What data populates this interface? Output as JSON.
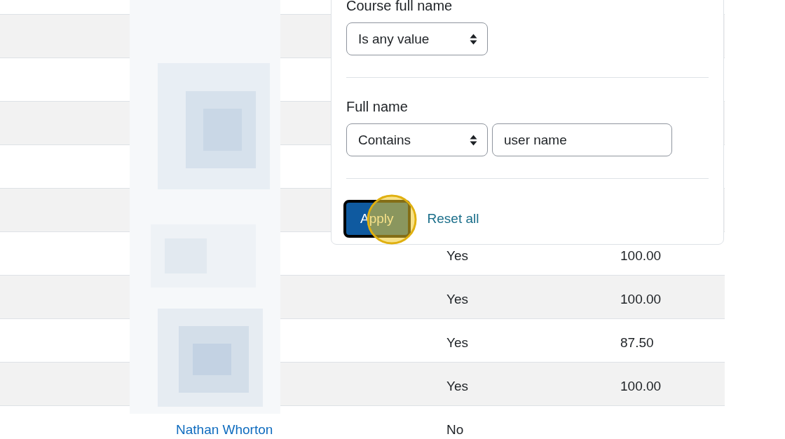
{
  "table": {
    "rows": [
      {
        "kind": "covered"
      },
      {
        "kind": "covered"
      },
      {
        "kind": "covered"
      },
      {
        "kind": "covered"
      },
      {
        "kind": "covered"
      },
      {
        "kind": "covered"
      },
      {
        "kind": "data",
        "completed": "Yes",
        "grade": "100.00"
      },
      {
        "kind": "data",
        "completed": "Yes",
        "grade": "100.00"
      },
      {
        "kind": "data",
        "completed": "Yes",
        "grade": "87.50"
      },
      {
        "kind": "data",
        "completed": "Yes",
        "grade": "100.00"
      },
      {
        "kind": "data",
        "name": "Nathan Whorton",
        "completed": "No"
      }
    ]
  },
  "filter_panel": {
    "filters": [
      {
        "label": "Course full name",
        "operator": "Is any value"
      },
      {
        "label": "Full name",
        "operator": "Contains",
        "value": "user name"
      }
    ],
    "apply": {
      "label": "Apply",
      "focused": true
    },
    "reset": "Reset all"
  }
}
